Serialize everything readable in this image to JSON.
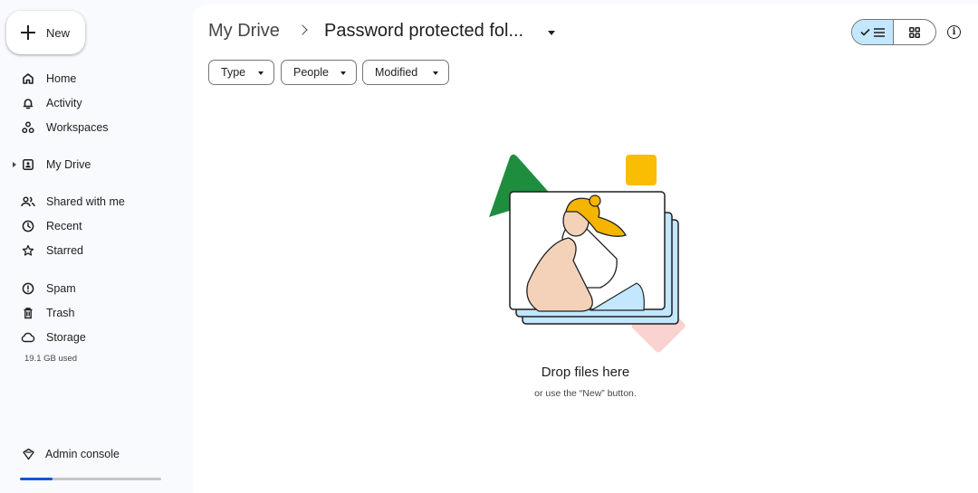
{
  "sidebar": {
    "new_label": "New",
    "items": [
      {
        "label": "Home",
        "icon": "home-icon"
      },
      {
        "label": "Activity",
        "icon": "bell-icon"
      },
      {
        "label": "Workspaces",
        "icon": "workspaces-icon"
      },
      {
        "label": "My Drive",
        "icon": "drive-icon"
      },
      {
        "label": "Shared with me",
        "icon": "people-icon"
      },
      {
        "label": "Recent",
        "icon": "clock-icon"
      },
      {
        "label": "Starred",
        "icon": "star-icon"
      },
      {
        "label": "Spam",
        "icon": "spam-icon"
      },
      {
        "label": "Trash",
        "icon": "trash-icon"
      },
      {
        "label": "Storage",
        "icon": "cloud-icon"
      }
    ],
    "storage_used": "19.1 GB used",
    "storage_fraction": 0.23,
    "admin_label": "Admin console"
  },
  "header": {
    "breadcrumb_root": "My Drive",
    "breadcrumb_current": "Password protected fol..."
  },
  "filters": [
    "Type",
    "People",
    "Modified"
  ],
  "empty_state": {
    "title": "Drop files here",
    "subtitle": "or use the “New” button."
  },
  "colors": {
    "accent": "#0b57d0",
    "selected_toggle": "#c2e7ff",
    "green": "#1e8e3e",
    "yellow": "#fbbc04",
    "pink": "#fad2cf"
  }
}
